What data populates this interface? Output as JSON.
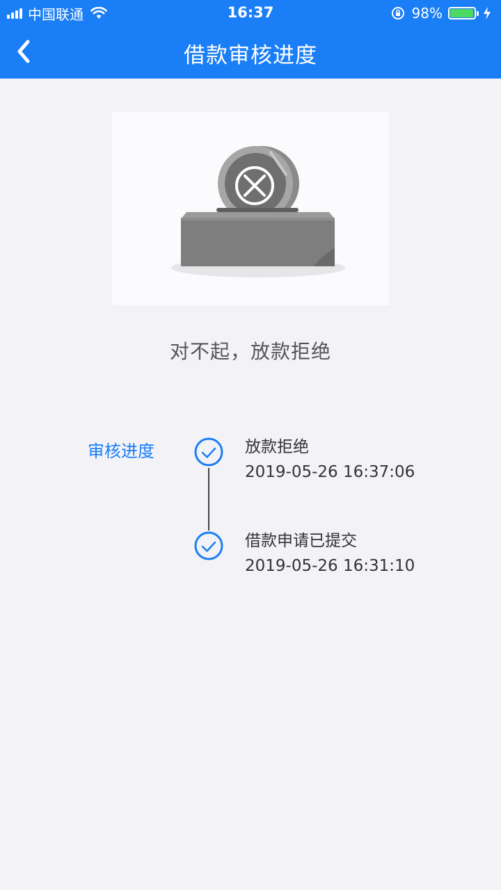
{
  "status_bar": {
    "carrier": "中国联通",
    "time": "16:37",
    "battery_percent": "98%",
    "battery_level": 0.98,
    "colors": {
      "battery_fill": "#4cd964"
    }
  },
  "nav": {
    "title": "借款审核进度",
    "back_icon": "chevron-left-icon"
  },
  "theme": {
    "primary": "#1a7ef6",
    "background": "#f3f3f7"
  },
  "result": {
    "illustration_icon": "rejected-coin-box-icon",
    "message": "对不起，放款拒绝"
  },
  "progress": {
    "label": "审核进度",
    "steps": [
      {
        "title": "放款拒绝",
        "time": "2019-05-26 16:37:06",
        "icon": "check-circle-icon"
      },
      {
        "title": "借款申请已提交",
        "time": "2019-05-26 16:31:10",
        "icon": "check-circle-icon"
      }
    ]
  }
}
